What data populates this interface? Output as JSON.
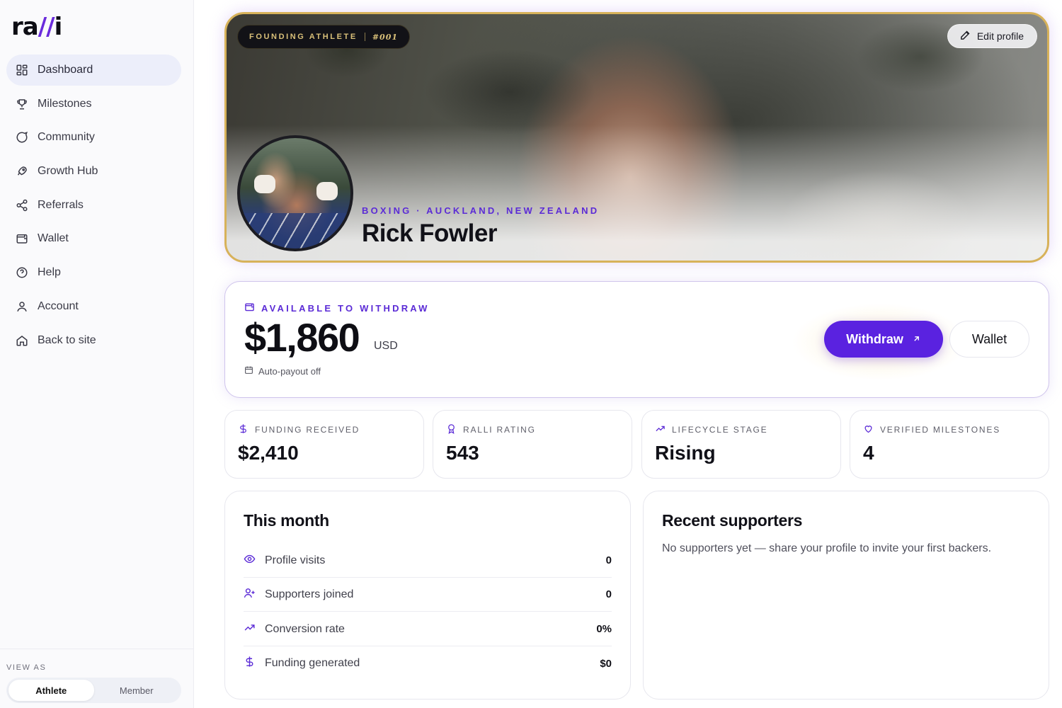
{
  "brand": {
    "logo_prefix": "ra",
    "logo_slash": "//",
    "logo_suffix": "i",
    "accent": "#5a22e0",
    "gold": "#d7b25a"
  },
  "sidebar": {
    "items": [
      {
        "label": "Dashboard",
        "icon": "dashboard-icon",
        "active": true
      },
      {
        "label": "Milestones",
        "icon": "trophy-icon"
      },
      {
        "label": "Community",
        "icon": "chat-bubble-icon"
      },
      {
        "label": "Growth Hub",
        "icon": "rocket-icon"
      },
      {
        "label": "Referrals",
        "icon": "share-icon"
      },
      {
        "label": "Wallet",
        "icon": "wallet-icon"
      },
      {
        "label": "Help",
        "icon": "help-circle-icon"
      },
      {
        "label": "Account",
        "icon": "user-icon"
      },
      {
        "label": "Back to site",
        "icon": "home-icon"
      }
    ],
    "view_as_label": "VIEW AS",
    "view_as_options": [
      "Athlete",
      "Member"
    ],
    "view_as_selected": "Athlete"
  },
  "hero": {
    "badge_text": "FOUNDING ATHLETE",
    "badge_number": "#001",
    "edit_label": "Edit profile",
    "sport_location": "BOXING · AUCKLAND, NEW ZEALAND",
    "athlete_name": "Rick Fowler"
  },
  "withdraw": {
    "label": "AVAILABLE TO WITHDRAW",
    "amount": "$1,860",
    "currency": "USD",
    "autopayout": "Auto-payout off",
    "withdraw_label": "Withdraw",
    "wallet_label": "Wallet"
  },
  "stats": [
    {
      "label": "FUNDING RECEIVED",
      "value": "$2,410",
      "icon": "dollar-icon"
    },
    {
      "label": "RALLI RATING",
      "value": "543",
      "icon": "award-icon"
    },
    {
      "label": "LIFECYCLE STAGE",
      "value": "Rising",
      "icon": "trending-up-icon"
    },
    {
      "label": "VERIFIED MILESTONES",
      "value": "4",
      "icon": "heart-icon"
    }
  ],
  "this_month": {
    "title": "This month",
    "rows": [
      {
        "label": "Profile visits",
        "value": "0",
        "icon": "eye-icon"
      },
      {
        "label": "Supporters joined",
        "value": "0",
        "icon": "user-plus-icon"
      },
      {
        "label": "Conversion rate",
        "value": "0%",
        "icon": "trending-up-icon"
      },
      {
        "label": "Funding generated",
        "value": "$0",
        "icon": "dollar-icon"
      }
    ]
  },
  "recent_supporters": {
    "title": "Recent supporters",
    "empty_text": "No supporters yet — share your profile to invite your first backers."
  }
}
